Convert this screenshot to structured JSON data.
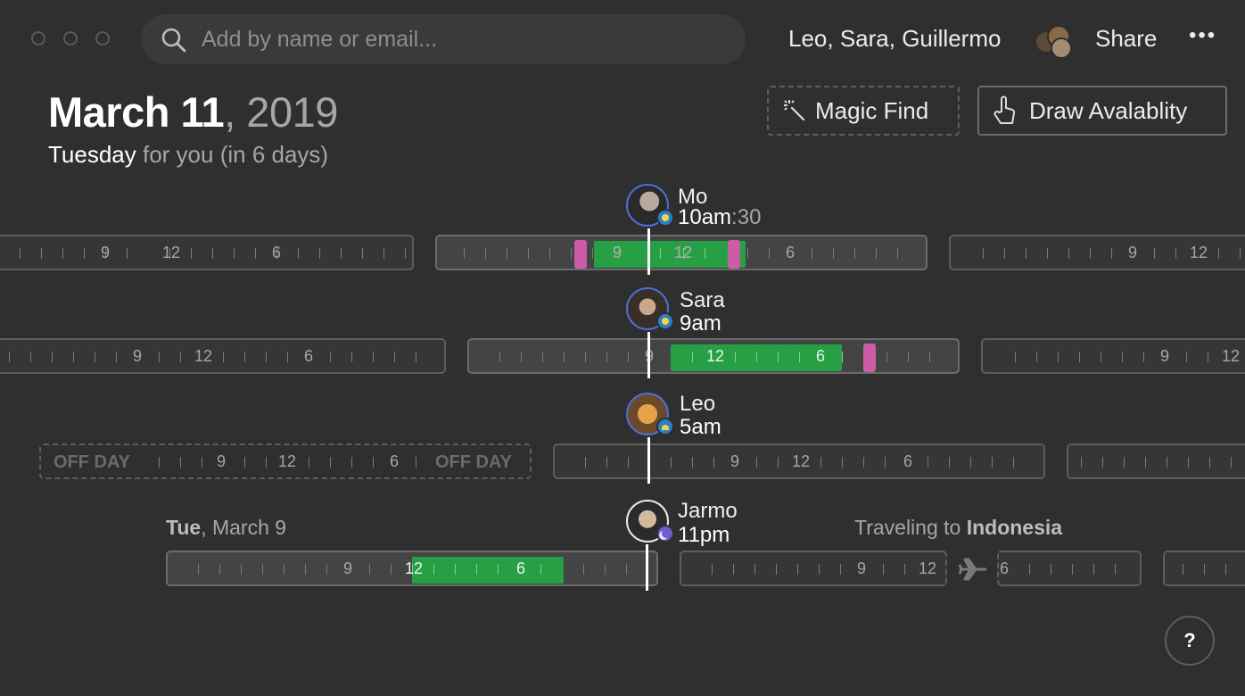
{
  "search": {
    "placeholder": "Add by name or email..."
  },
  "toolbar": {
    "participants": "Leo, Sara, Guillermo",
    "share_label": "Share",
    "more_label": "•••"
  },
  "header": {
    "date_main": "March 11",
    "date_year": ", 2019",
    "weekday": "Tuesday",
    "relative": " for you (in 6 days)"
  },
  "actions": {
    "magic_find": "Magic Find",
    "draw_availability": "Draw Avalablity"
  },
  "people": [
    {
      "name": "Mo",
      "time": "10am",
      "time_minutes": ":30",
      "status": "day"
    },
    {
      "name": "Sara",
      "time": "9am",
      "status": "day"
    },
    {
      "name": "Leo",
      "time": "5am",
      "status": "day"
    },
    {
      "name": "Jarmo",
      "time": "11pm",
      "status": "night"
    }
  ],
  "tick_labels": {
    "morning": "9",
    "noon": "12",
    "evening": "6"
  },
  "offday_label": "OFF DAY",
  "jarmo_date": {
    "weekday": "Tue",
    "rest": ", March 9"
  },
  "travel": {
    "prefix": "Traveling to ",
    "destination": "Indonesia"
  },
  "help_label": "?",
  "colors": {
    "background": "#2f2f2f",
    "available": "#27a045",
    "busy": "#cc5ca6",
    "avatar_ring": "#4d6fd9",
    "now_line": "#ffffff"
  }
}
